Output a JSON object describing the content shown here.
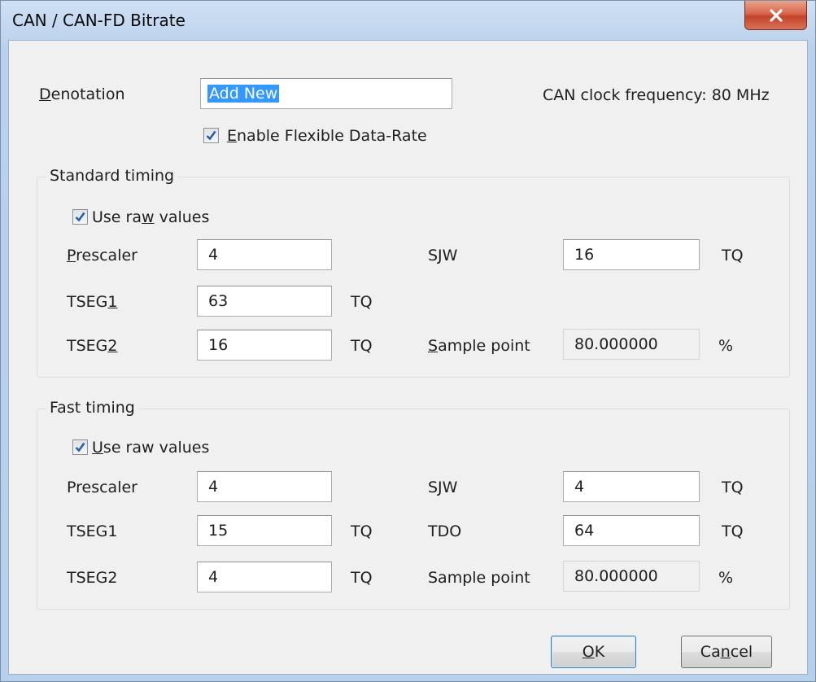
{
  "window": {
    "title": "CAN / CAN-FD Bitrate"
  },
  "denotation": {
    "label_first": "D",
    "label_rest": "enotation",
    "value": "Add New"
  },
  "clock": {
    "text": "CAN clock frequency:  80 MHz"
  },
  "enable_fd": {
    "label_first": "E",
    "label_rest": "nable Flexible Data-Rate",
    "checked": true
  },
  "standard": {
    "title": "Standard timing",
    "raw": {
      "pre": "Use ra",
      "ul": "w",
      "post": " values",
      "checked": true
    },
    "prescaler": {
      "label_first": "P",
      "label_rest": "rescaler",
      "value": "4"
    },
    "tseg1": {
      "label_pre": "TSEG",
      "label_ul": "1",
      "value": "63",
      "unit": "TQ"
    },
    "tseg2": {
      "label_pre": "TSEG",
      "label_ul": "2",
      "value": "16",
      "unit": "TQ"
    },
    "sjw": {
      "label": "SJW",
      "value": "16",
      "unit": "TQ"
    },
    "sample": {
      "label_first": "S",
      "label_rest": "ample point",
      "value": "80.000000",
      "unit": "%"
    }
  },
  "fast": {
    "title": "Fast timing",
    "raw": {
      "first": "U",
      "rest": "se raw values",
      "checked": true
    },
    "prescaler": {
      "label": "Prescaler",
      "value": "4"
    },
    "tseg1": {
      "label": "TSEG1",
      "value": "15",
      "unit": "TQ"
    },
    "tseg2": {
      "label": "TSEG2",
      "value": "4",
      "unit": "TQ"
    },
    "sjw": {
      "label": "SJW",
      "value": "4",
      "unit": "TQ"
    },
    "tdo": {
      "label": "TDO",
      "value": "64",
      "unit": "TQ"
    },
    "sample": {
      "label": "Sample point",
      "value": "80.000000",
      "unit": "%"
    }
  },
  "buttons": {
    "ok": {
      "first": "O",
      "rest": "K"
    },
    "cancel": {
      "pre": "Ca",
      "ul": "n",
      "post": "cel"
    }
  },
  "icons": {
    "close": "close-icon",
    "check": "checkmark-icon"
  },
  "colors": {
    "selection": "#3399ff",
    "close_button": "#c4432b",
    "title_bar": "#b9d1ec"
  }
}
